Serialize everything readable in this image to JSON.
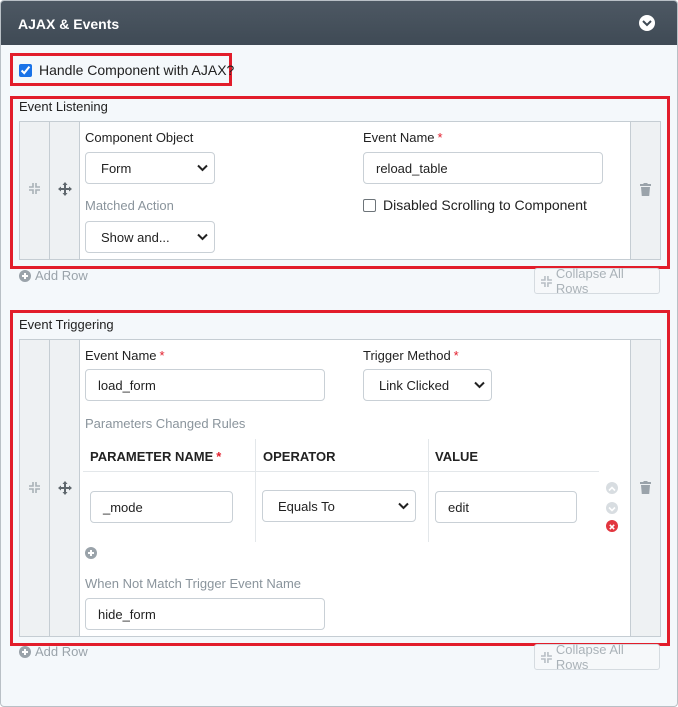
{
  "panel": {
    "title": "AJAX & Events"
  },
  "handle_ajax": {
    "label": "Handle Component with AJAX?",
    "checked": true
  },
  "event_listening": {
    "section_title": "Event Listening",
    "component_object": {
      "label": "Component Object",
      "value": "Form"
    },
    "matched_action": {
      "label": "Matched Action",
      "value": "Show and..."
    },
    "event_name": {
      "label": "Event Name",
      "value": "reload_table"
    },
    "disable_scrolling": {
      "label": "Disabled Scrolling to Component",
      "checked": false
    },
    "add_row": "Add Row",
    "collapse_all": "Collapse All Rows"
  },
  "event_triggering": {
    "section_title": "Event Triggering",
    "event_name": {
      "label": "Event Name",
      "value": "load_form"
    },
    "trigger_method": {
      "label": "Trigger Method",
      "value": "Link Clicked"
    },
    "params_label": "Parameters Changed Rules",
    "columns": {
      "param_name": "PARAMETER NAME",
      "operator": "OPERATOR",
      "value": "VALUE"
    },
    "row": {
      "param_name": "_mode",
      "operator": "Equals To",
      "value": "edit"
    },
    "not_match": {
      "label": "When Not Match Trigger Event Name",
      "value": "hide_form"
    },
    "add_row": "Add Row",
    "collapse_all": "Collapse All Rows"
  }
}
